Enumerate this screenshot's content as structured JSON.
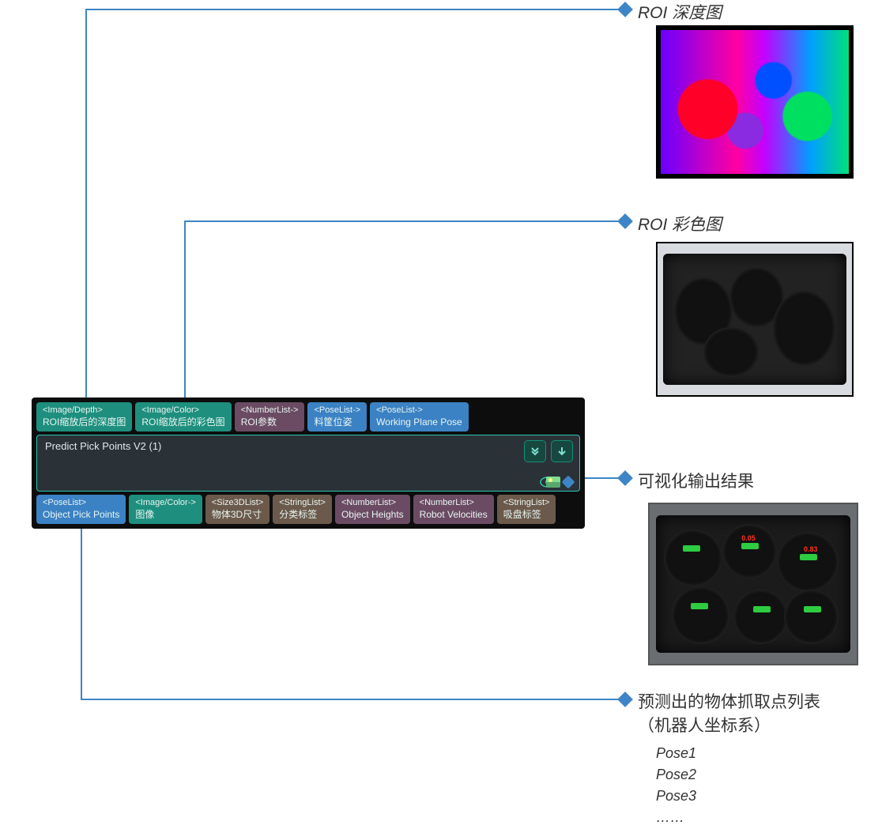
{
  "callouts": {
    "depth": "ROI 深度图",
    "color": "ROI 彩色图",
    "viz": "可视化输出结果",
    "pick_line1": "预测出的物体抓取点列表",
    "pick_line2": "（机器人坐标系）"
  },
  "pose_list": {
    "p1": "Pose1",
    "p2": "Pose2",
    "p3": "Pose3",
    "more": "……"
  },
  "node": {
    "title": "Predict Pick Points V2 (1)",
    "inputs": [
      {
        "type": "<Image/Depth>",
        "label": "ROI缩放后的深度图",
        "cls": "teal"
      },
      {
        "type": "<Image/Color>",
        "label": "ROI缩放后的彩色图",
        "cls": "teal"
      },
      {
        "type": "<NumberList->",
        "label": "ROI参数",
        "cls": "purple"
      },
      {
        "type": "<PoseList->",
        "label": "料筐位姿",
        "cls": "blue"
      },
      {
        "type": "<PoseList->",
        "label": "Working Plane Pose",
        "cls": "blue"
      }
    ],
    "outputs": [
      {
        "type": "<PoseList>",
        "label": "Object Pick Points",
        "cls": "blue"
      },
      {
        "type": "<Image/Color->",
        "label": "图像",
        "cls": "teal"
      },
      {
        "type": "<Size3DList>",
        "label": "物体3D尺寸",
        "cls": "brown"
      },
      {
        "type": "<StringList>",
        "label": "分类标签",
        "cls": "brown"
      },
      {
        "type": "<NumberList>",
        "label": "Object Heights",
        "cls": "purple"
      },
      {
        "type": "<NumberList>",
        "label": "Robot Velocities",
        "cls": "purple"
      },
      {
        "type": "<StringList>",
        "label": "吸盘标签",
        "cls": "brown"
      }
    ]
  }
}
